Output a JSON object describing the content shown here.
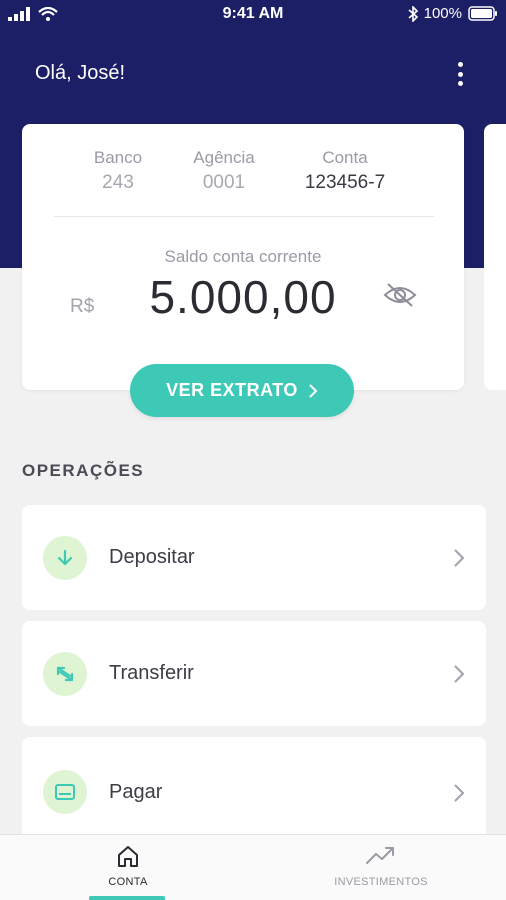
{
  "status_bar": {
    "time": "9:41 AM",
    "battery": "100%"
  },
  "header": {
    "greeting": "Olá, José!"
  },
  "account": {
    "bank_label": "Banco",
    "bank_value": "243",
    "agency_label": "Agência",
    "agency_value": "0001",
    "account_label": "Conta",
    "account_value": "123456-7",
    "balance_label": "Saldo conta corrente",
    "currency": "R$",
    "balance": "5.000,00"
  },
  "statement_button": {
    "label": "VER EXTRATO"
  },
  "operations": {
    "title": "OPERAÇÕES",
    "items": [
      {
        "label": "Depositar",
        "icon": "arrow-down-icon"
      },
      {
        "label": "Transferir",
        "icon": "transfer-arrows-icon"
      },
      {
        "label": "Pagar",
        "icon": "card-icon"
      }
    ]
  },
  "tabbar": {
    "tabs": [
      {
        "label": "CONTA",
        "icon": "home-icon",
        "active": true
      },
      {
        "label": "INVESTIMENTOS",
        "icon": "trend-up-icon",
        "active": false
      }
    ]
  },
  "colors": {
    "primary": "#1c1f66",
    "accent": "#3ec9b7",
    "icon_bg": "#dff4d2",
    "background": "#f1f1f2"
  }
}
